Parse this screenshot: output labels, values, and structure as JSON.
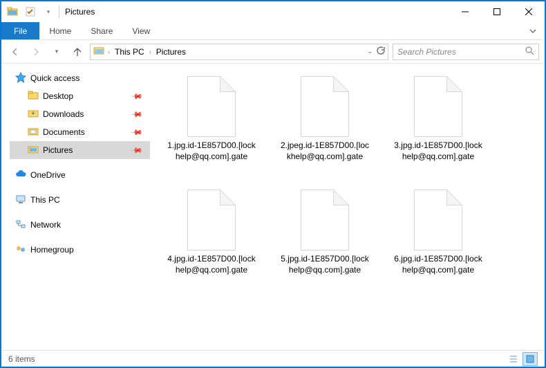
{
  "titlebar": {
    "title": "Pictures"
  },
  "ribbon": {
    "file": "File",
    "tabs": [
      "Home",
      "Share",
      "View"
    ]
  },
  "breadcrumbs": [
    "This PC",
    "Pictures"
  ],
  "search": {
    "placeholder": "Search Pictures"
  },
  "sidebar": {
    "quick_access": "Quick access",
    "pinned": [
      "Desktop",
      "Downloads",
      "Documents",
      "Pictures"
    ],
    "onedrive": "OneDrive",
    "this_pc": "This PC",
    "network": "Network",
    "homegroup": "Homegroup"
  },
  "files": [
    "1.jpg.id-1E857D00.[lockhelp@qq.com].gate",
    "2.jpeg.id-1E857D00.[lockhelp@qq.com].gate",
    "3.jpg.id-1E857D00.[lockhelp@qq.com].gate",
    "4.jpg.id-1E857D00.[lockhelp@qq.com].gate",
    "5.jpg.id-1E857D00.[lockhelp@qq.com].gate",
    "6.jpg.id-1E857D00.[lockhelp@qq.com].gate"
  ],
  "status": {
    "count": "6 items"
  }
}
